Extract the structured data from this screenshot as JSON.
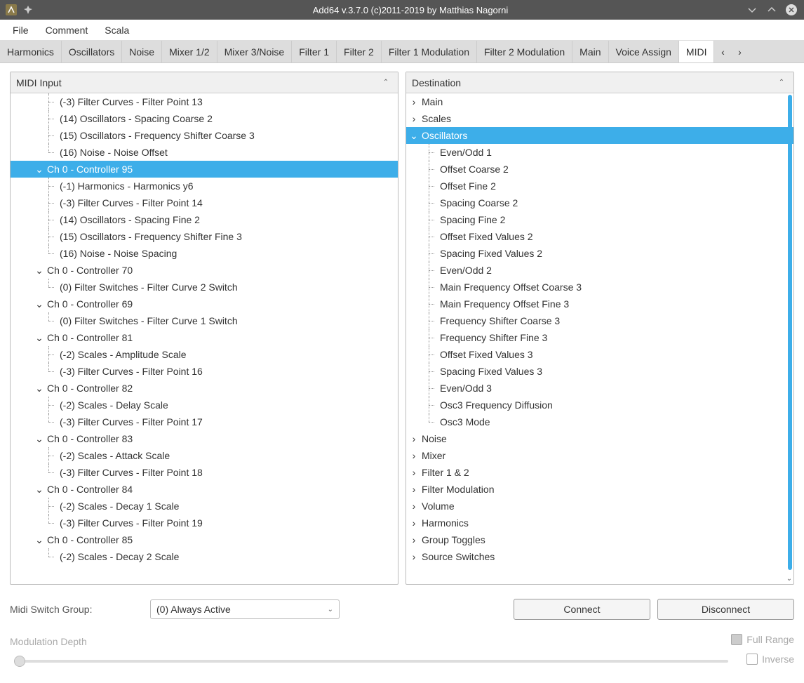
{
  "window": {
    "title": "Add64  v.3.7.0   (c)2011-2019 by Matthias Nagorni"
  },
  "menu": [
    "File",
    "Comment",
    "Scala"
  ],
  "tabs": [
    "Harmonics",
    "Oscillators",
    "Noise",
    "Mixer 1/2",
    "Mixer 3/Noise",
    "Filter 1",
    "Filter 2",
    "Filter 1 Modulation",
    "Filter 2 Modulation",
    "Main",
    "Voice Assign",
    "MIDI"
  ],
  "active_tab": "MIDI",
  "midi_input": {
    "title": "MIDI Input",
    "rows": [
      {
        "t": "leaf",
        "label": "(-3) Filter Curves - Filter Point 13",
        "nl": true
      },
      {
        "t": "leaf",
        "label": "(14) Oscillators - Spacing Coarse 2",
        "nl": true
      },
      {
        "t": "leaf",
        "label": "(15) Oscillators - Frequency Shifter Coarse 3",
        "nl": true
      },
      {
        "t": "leaf",
        "label": "(16) Noise - Noise Offset"
      },
      {
        "t": "parent",
        "label": "Ch 0 - Controller 95",
        "selected": true
      },
      {
        "t": "leaf",
        "label": "(-1) Harmonics - Harmonics y6",
        "nl": true
      },
      {
        "t": "leaf",
        "label": "(-3) Filter Curves - Filter Point 14",
        "nl": true
      },
      {
        "t": "leaf",
        "label": "(14) Oscillators - Spacing Fine 2",
        "nl": true
      },
      {
        "t": "leaf",
        "label": "(15) Oscillators - Frequency Shifter Fine 3",
        "nl": true
      },
      {
        "t": "leaf",
        "label": "(16) Noise - Noise Spacing"
      },
      {
        "t": "parent",
        "label": "Ch 0 - Controller 70"
      },
      {
        "t": "leaf",
        "label": "(0) Filter Switches - Filter Curve 2  Switch"
      },
      {
        "t": "parent",
        "label": "Ch 0 - Controller 69"
      },
      {
        "t": "leaf",
        "label": "(0) Filter Switches - Filter Curve 1  Switch"
      },
      {
        "t": "parent",
        "label": "Ch 0 - Controller 81"
      },
      {
        "t": "leaf",
        "label": "(-2) Scales - Amplitude Scale",
        "nl": true
      },
      {
        "t": "leaf",
        "label": "(-3) Filter Curves - Filter Point 16"
      },
      {
        "t": "parent",
        "label": "Ch 0 - Controller 82"
      },
      {
        "t": "leaf",
        "label": "(-2) Scales - Delay Scale",
        "nl": true
      },
      {
        "t": "leaf",
        "label": "(-3) Filter Curves - Filter Point 17"
      },
      {
        "t": "parent",
        "label": "Ch 0 - Controller 83"
      },
      {
        "t": "leaf",
        "label": "(-2) Scales - Attack Scale",
        "nl": true
      },
      {
        "t": "leaf",
        "label": "(-3) Filter Curves - Filter Point 18"
      },
      {
        "t": "parent",
        "label": "Ch 0 - Controller 84"
      },
      {
        "t": "leaf",
        "label": "(-2) Scales - Decay 1 Scale",
        "nl": true
      },
      {
        "t": "leaf",
        "label": "(-3) Filter Curves - Filter Point 19"
      },
      {
        "t": "parent",
        "label": "Ch 0 - Controller 85"
      },
      {
        "t": "leaf",
        "label": "(-2) Scales - Decay 2 Scale"
      }
    ]
  },
  "destination": {
    "title": "Destination",
    "rows": [
      {
        "t": "parent",
        "label": "Main",
        "open": false
      },
      {
        "t": "parent",
        "label": "Scales",
        "open": false
      },
      {
        "t": "parent",
        "label": "Oscillators",
        "open": true,
        "selected": true
      },
      {
        "t": "leaf",
        "label": "Even/Odd 1",
        "nl": true
      },
      {
        "t": "leaf",
        "label": "Offset Coarse 2",
        "nl": true
      },
      {
        "t": "leaf",
        "label": "Offset Fine 2",
        "nl": true
      },
      {
        "t": "leaf",
        "label": "Spacing Coarse 2",
        "nl": true
      },
      {
        "t": "leaf",
        "label": "Spacing Fine 2",
        "nl": true
      },
      {
        "t": "leaf",
        "label": "Offset Fixed Values 2",
        "nl": true
      },
      {
        "t": "leaf",
        "label": "Spacing Fixed Values 2",
        "nl": true
      },
      {
        "t": "leaf",
        "label": "Even/Odd 2",
        "nl": true
      },
      {
        "t": "leaf",
        "label": "Main Frequency Offset Coarse 3",
        "nl": true
      },
      {
        "t": "leaf",
        "label": "Main Frequency Offset Fine 3",
        "nl": true
      },
      {
        "t": "leaf",
        "label": "Frequency Shifter Coarse 3",
        "nl": true
      },
      {
        "t": "leaf",
        "label": "Frequency Shifter Fine 3",
        "nl": true
      },
      {
        "t": "leaf",
        "label": "Offset Fixed Values 3",
        "nl": true
      },
      {
        "t": "leaf",
        "label": "Spacing Fixed Values 3",
        "nl": true
      },
      {
        "t": "leaf",
        "label": "Even/Odd 3",
        "nl": true
      },
      {
        "t": "leaf",
        "label": "Osc3 Frequency Diffusion",
        "nl": true
      },
      {
        "t": "leaf",
        "label": "Osc3 Mode"
      },
      {
        "t": "parent",
        "label": "Noise",
        "open": false
      },
      {
        "t": "parent",
        "label": "Mixer",
        "open": false
      },
      {
        "t": "parent",
        "label": "Filter 1 & 2",
        "open": false
      },
      {
        "t": "parent",
        "label": "Filter Modulation",
        "open": false
      },
      {
        "t": "parent",
        "label": "Volume",
        "open": false
      },
      {
        "t": "parent",
        "label": "Harmonics",
        "open": false
      },
      {
        "t": "parent",
        "label": "Group Toggles",
        "open": false
      },
      {
        "t": "parent",
        "label": "Source Switches",
        "open": false
      }
    ]
  },
  "bottom": {
    "switch_group_label": "Midi Switch Group:",
    "switch_group_value": "(0) Always Active",
    "connect_label": "Connect",
    "disconnect_label": "Disconnect",
    "mod_depth_label": "Modulation Depth",
    "full_range_label": "Full Range",
    "inverse_label": "Inverse"
  }
}
